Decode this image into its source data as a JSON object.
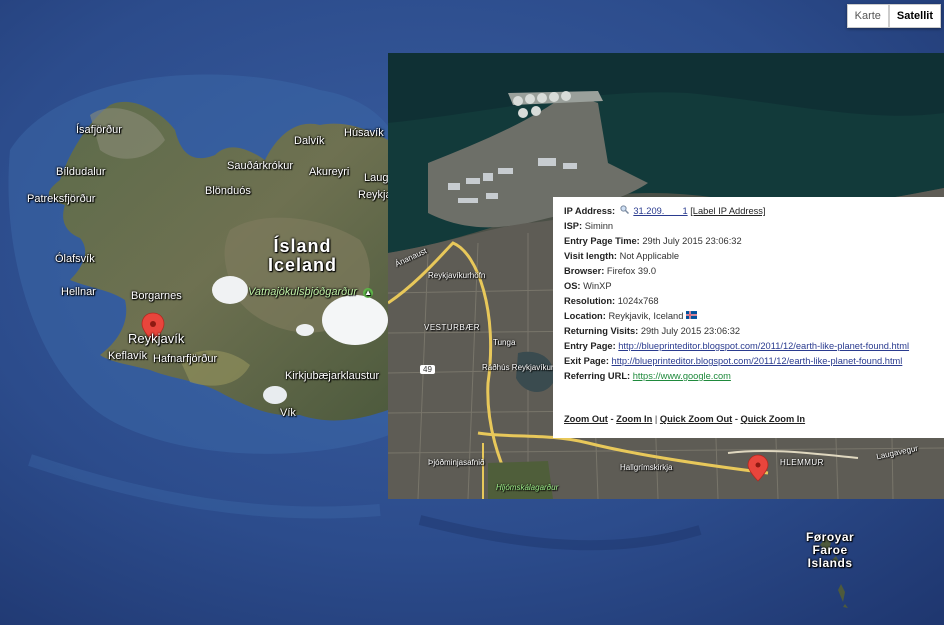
{
  "map_type": {
    "karte": "Karte",
    "satellit": "Satellit",
    "active": "Satellit"
  },
  "map_labels": {
    "isafjordur": "Ísafjörður",
    "bildudalur": "Bíldudalur",
    "patreksfjordur": "Patreksfjörður",
    "olafsvik": "Ólafsvík",
    "hellnar": "Hellnar",
    "borgarnes": "Borgarnes",
    "reykjavik": "Reykjavík",
    "keflavik": "Keflavík",
    "hafnarfjordur": "Hafnarfjörður",
    "saudarkrokur": "Sauðárkrókur",
    "blonduos": "Blönduós",
    "dalvik": "Dalvík",
    "husavik": "Húsavík",
    "akureyri": "Akureyri",
    "laug": "Laug",
    "reykj": "Reykja",
    "island": "Ísland",
    "iceland": "Iceland",
    "vatnajokull": "Vatnajökulsþjóðgarður",
    "kirkjubaejarklaustur": "Kirkjubæjarklaustur",
    "vik": "Vík",
    "foroyar": "Føroyar",
    "faroe": "Faroe",
    "islands": "Islands"
  },
  "inset_labels": {
    "reykjavikurhofn": "Reykjavíkurhöfn",
    "vesturbaer": "VESTURBÆR",
    "radhus": "Ráðhús Reykjavíkur",
    "thjodminjasafnid": "Þjóðminjasafnið",
    "hljomskalagardur": "Hljómskálagarður",
    "hallgrimskirkja": "Hallgrímskirkja",
    "hlemmur": "HLEMMUR",
    "tunga": "Tunga",
    "road_49": "49",
    "anahaust": "Ánanaust",
    "laugavegur": "Laugavegur"
  },
  "info": {
    "ip_label": "IP Address:",
    "ip_value": "31.209.       1",
    "ip_action": "[Label IP Address]",
    "isp_label": "ISP:",
    "isp_value": "Siminn",
    "entry_time_label": "Entry Page Time:",
    "entry_time_value": "29th July 2015 23:06:32",
    "visit_length_label": "Visit length:",
    "visit_length_value": "Not Applicable",
    "browser_label": "Browser:",
    "browser_value": "Firefox 39.0",
    "os_label": "OS:",
    "os_value": "WinXP",
    "resolution_label": "Resolution:",
    "resolution_value": "1024x768",
    "location_label": "Location:",
    "location_value": "Reykjavik, Iceland",
    "returning_label": "Returning Visits:",
    "returning_value": "29th July 2015 23:06:32",
    "entry_page_label": "Entry Page:",
    "entry_page_value": "http://blueprinteditor.blogspot.com/2011/12/earth-like-planet-found.html",
    "exit_page_label": "Exit Page:",
    "exit_page_value": "http://blueprinteditor.blogspot.com/2011/12/earth-like-planet-found.html",
    "referring_label": "Referring URL:",
    "referring_value": "https://www.google.com",
    "zoom_out": "Zoom Out",
    "zoom_in": "Zoom In",
    "quick_zoom_out": "Quick Zoom Out",
    "quick_zoom_in": "Quick Zoom In",
    "sep_dash": " - ",
    "sep_pipe": " | "
  },
  "colors": {
    "ocean": "#2b4a86",
    "link": "#2a3b8f",
    "referrer": "#1f8a3c",
    "pin": "#e8453c"
  }
}
